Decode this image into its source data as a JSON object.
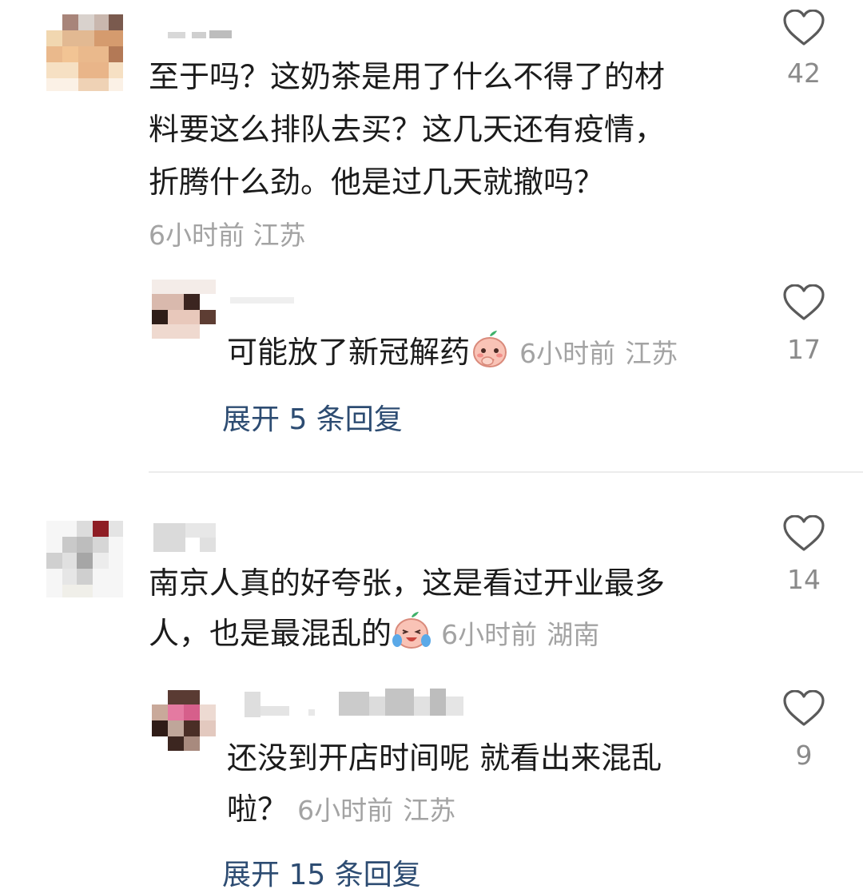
{
  "comments": [
    {
      "text_line1": "至于吗？这奶茶是用了什么不得了的材",
      "text_line2": "料要这么排队去买？这几天还有疫情，",
      "text_line3": "折腾什么劲。他是过几天就撤吗？",
      "time": "6小时前",
      "location": "江苏",
      "likes": "42",
      "reply": {
        "text": "可能放了新冠解药",
        "time": "6小时前",
        "location": "江苏",
        "likes": "17"
      },
      "expand_label": "展开 5 条回复"
    },
    {
      "text_line1": "南京人真的好夸张，这是看过开业最多",
      "text_line2": "人，也是最混乱的",
      "time": "6小时前",
      "location": "湖南",
      "likes": "14",
      "reply": {
        "text_line1": "还没到开店时间呢 就看出来混乱",
        "text_line2": "啦？",
        "time": "6小时前",
        "location": "江苏",
        "likes": "9"
      },
      "expand_label": "展开 15 条回复"
    }
  ],
  "icons": {
    "like": "heart-outline-icon",
    "emoji1": "peach-shy-emoji",
    "emoji2": "peach-laugh-cry-emoji"
  },
  "colors": {
    "link": "#2d4c72",
    "meta": "#a3a3a3",
    "text": "#1b1b1b"
  }
}
